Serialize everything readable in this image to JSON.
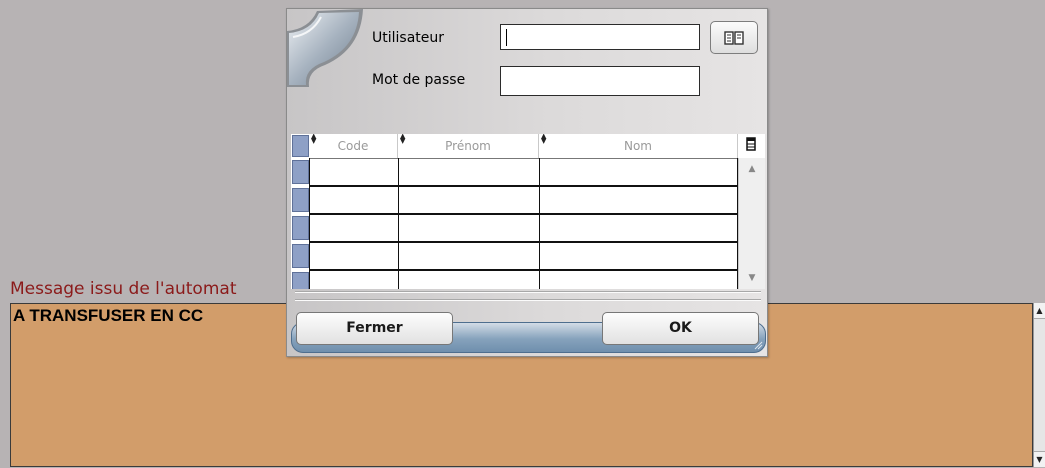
{
  "background": {
    "label": "Message issu de l'automat",
    "message_text": "A TRANSFUSER EN CC",
    "scroll_up_icon": "arrow-up",
    "scroll_down_icon": "arrow-down",
    "colors": {
      "label": "#8b1a1a",
      "message_bg": "#d29d6a",
      "window_bg": "#b7b3b4"
    }
  },
  "dialog": {
    "logo_icon": "swoosh-logo",
    "user_label": "Utilisateur",
    "user_value": "",
    "password_label": "Mot de passe",
    "password_value": "",
    "lookup_icon": "book-icon",
    "table": {
      "columns": [
        "Code",
        "Prénom",
        "Nom"
      ],
      "rows": [
        [
          "",
          "",
          ""
        ],
        [
          "",
          "",
          ""
        ],
        [
          "",
          "",
          ""
        ],
        [
          "",
          "",
          ""
        ],
        [
          "",
          "",
          ""
        ]
      ]
    },
    "buttons": {
      "close_label": "Fermer",
      "ok_label": "OK"
    },
    "colors": {
      "row_selector": "#8ea0c6",
      "footer_bar": "#86a2bc"
    }
  }
}
